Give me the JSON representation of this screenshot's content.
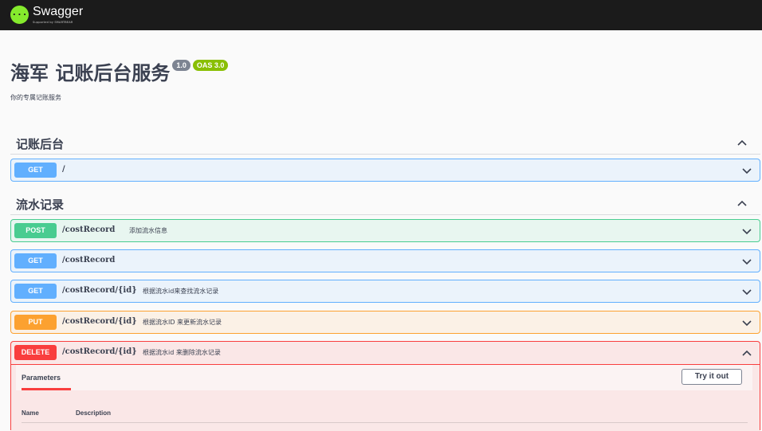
{
  "header": {
    "logo_word": "Swagger",
    "logo_sub": "Supported by SMARTBEAR",
    "logo_glyph": "{···}"
  },
  "info": {
    "title": "海军 记账后台服务",
    "version": "1.0",
    "oas": "OAS 3.0",
    "description": "你的专属记账服务"
  },
  "tags": [
    {
      "name": "记账后台",
      "expanded": true
    },
    {
      "name": "流水记录",
      "expanded": true
    }
  ],
  "operations": [
    {
      "method": "GET",
      "path": "/",
      "summary": "",
      "expanded": false
    },
    {
      "method": "POST",
      "path": "/costRecord",
      "summary": "添加流水信息",
      "expanded": false
    },
    {
      "method": "GET",
      "path": "/costRecord",
      "summary": "",
      "expanded": false
    },
    {
      "method": "GET",
      "path": "/costRecord/{id}",
      "summary": "根据流水id来查找流水记录",
      "expanded": false
    },
    {
      "method": "PUT",
      "path": "/costRecord/{id}",
      "summary": "根据流水ID 来更新流水记录",
      "expanded": false
    },
    {
      "method": "DELETE",
      "path": "/costRecord/{id}",
      "summary": "根据流水id 来删除流水记录",
      "expanded": true
    }
  ],
  "delete_panel": {
    "parameters_tab": "Parameters",
    "try_button": "Try it out",
    "col_name": "Name",
    "col_description": "Description"
  },
  "colors": {
    "get": "#61affe",
    "post": "#49cc90",
    "put": "#fca130",
    "delete": "#f93e3e",
    "topbar": "#1b1b1b"
  }
}
